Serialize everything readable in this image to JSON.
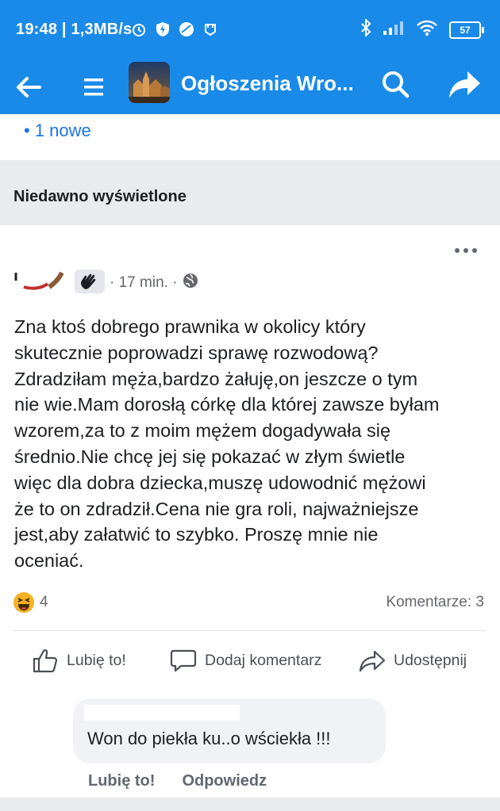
{
  "status_bar": {
    "time": "19:48 | 1,3MB/s",
    "battery": "57"
  },
  "app_bar": {
    "title": "Ogłoszenia Wro..."
  },
  "new_posts": {
    "label": "• 1 nowe"
  },
  "section": {
    "recently_viewed": "Niedawno wyświetlone"
  },
  "post": {
    "time": "· 17 min. ·",
    "text": "Zna ktoś dobrego prawnika w okolicy który\nskutecznie poprowadzi sprawę rozwodową?\nZdradziłam męża,bardzo żałuję,on jeszcze o tym\nnie wie.Mam dorosłą córkę dla której zawsze byłam\nwzorem,za to z moim mężem dogadywała się\nśrednio.Nie chcę jej się pokazać w złym świetle\nwięc dla dobra dziecka,muszę udowodnić mężowi\nże to on zdradził.Cena nie gra roli, najważniejsze\njest,aby załatwić to szybko. Proszę mnie nie\noceniać.",
    "reaction_count": "4",
    "comments_count": "Komentarze: 3",
    "actions": {
      "like": "Lubię to!",
      "comment": "Dodaj komentarz",
      "share": "Udostępnij"
    }
  },
  "comment": {
    "text": "Won do piekła ku..o wściekła !!!",
    "like": "Lubię to!",
    "reply": "Odpowiedz"
  },
  "colors": {
    "brand_blue": "#1a8ae8",
    "link_blue": "#1a73e8",
    "background_grey": "#e9ebee"
  }
}
